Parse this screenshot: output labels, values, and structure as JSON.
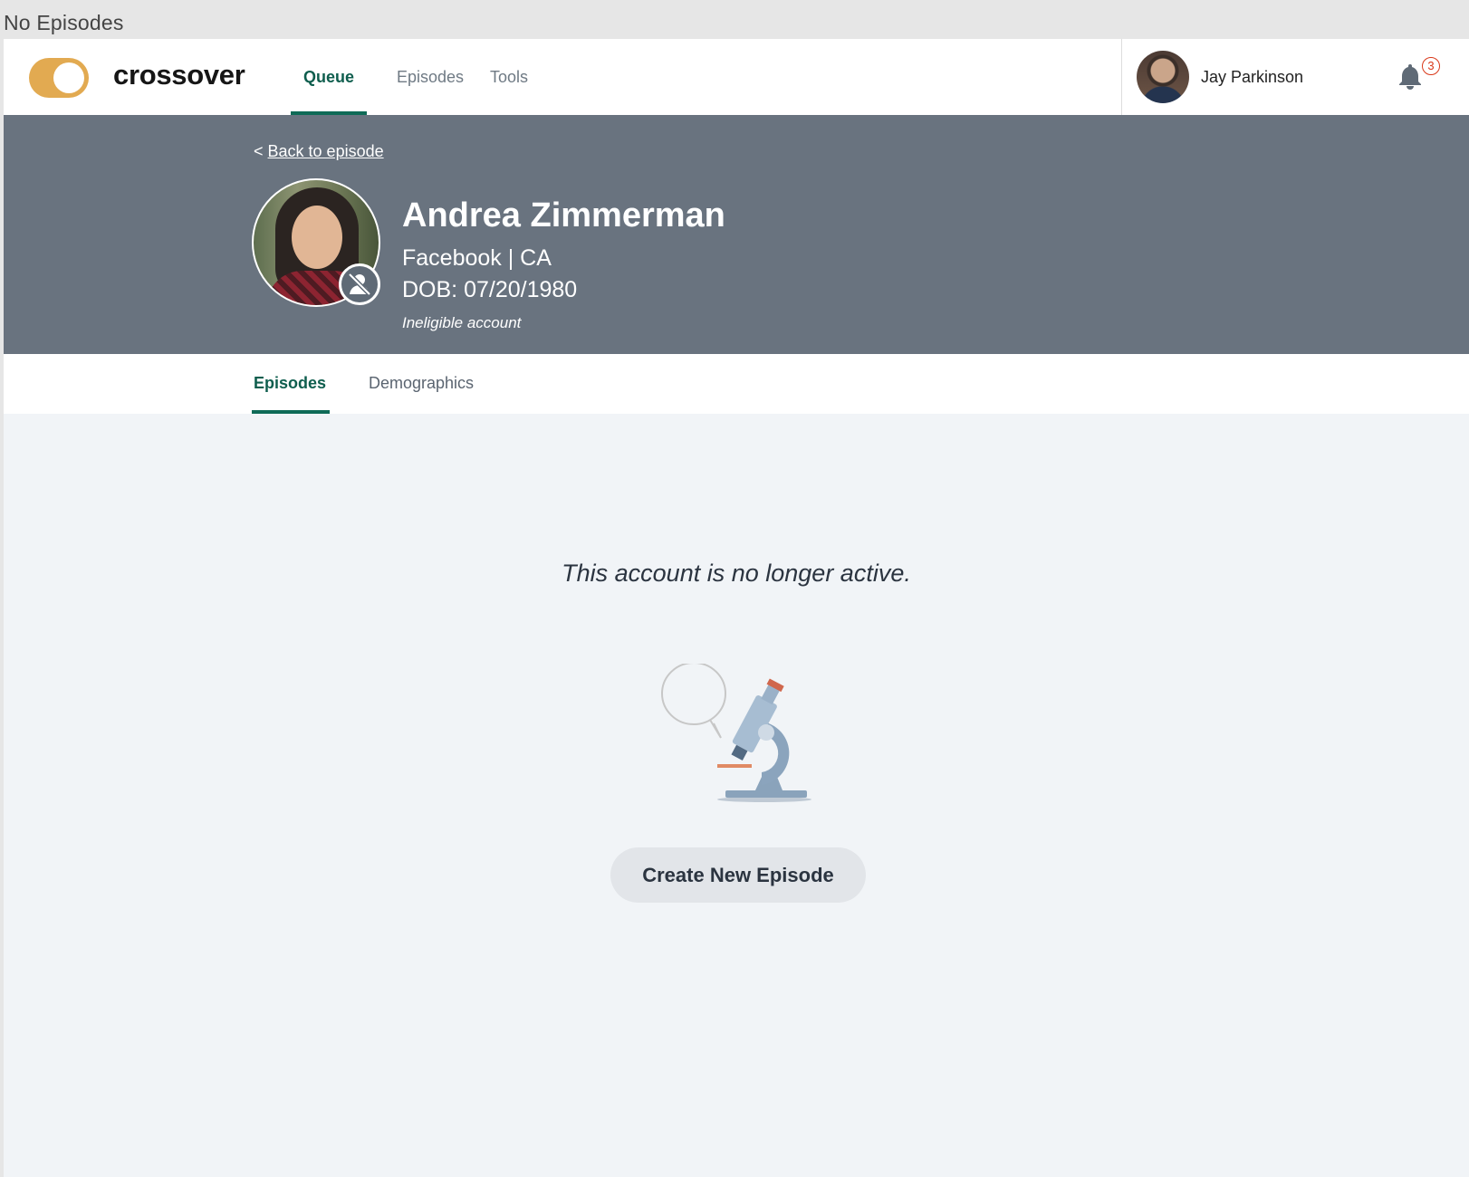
{
  "window": {
    "title": "No Episodes"
  },
  "brand": {
    "name": "crossover",
    "color": "#e2aa51",
    "icon": "toggle-logo-icon"
  },
  "nav": {
    "items": [
      {
        "label": "Queue",
        "active": true
      },
      {
        "label": "Episodes",
        "active": false
      },
      {
        "label": "Tools",
        "active": false
      }
    ],
    "accent": "#0f6b57"
  },
  "user": {
    "name": "Jay Parkinson",
    "avatar": "avatar",
    "notifications": "3"
  },
  "patient": {
    "back_prefix": "<",
    "back_label": "Back to episode",
    "name": "Andrea Zimmerman",
    "org": "Facebook | CA",
    "dob": "DOB: 07/20/1980",
    "status": "Ineligible account",
    "status_icon": "inactive-user-icon",
    "band_color": "#69737f"
  },
  "tabs": [
    {
      "label": "Episodes",
      "active": true
    },
    {
      "label": "Demographics",
      "active": false
    }
  ],
  "empty_state": {
    "message": "This account is no longer active.",
    "illustration": "microscope-icon",
    "button_label": "Create New Episode"
  }
}
